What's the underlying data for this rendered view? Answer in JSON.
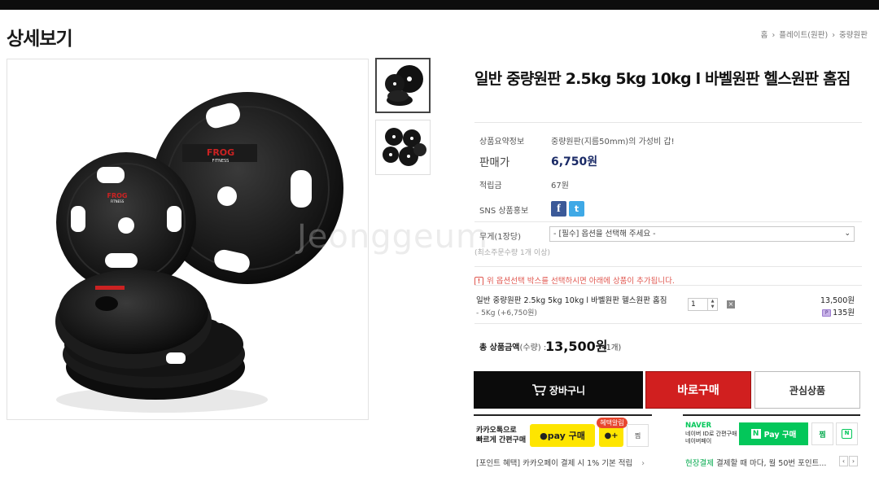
{
  "page": {
    "title": "상세보기",
    "breadcrumb": [
      "홈",
      "플레이트(원판)",
      "중량원판"
    ],
    "watermark": "Jeonggeum"
  },
  "product": {
    "title": "일반 중량원판 2.5kg 5kg 10kg l 바벨원판 헬스원판 홈짐",
    "summary_label": "상품요약정보",
    "summary_value": "중량원판(지름50mm)의 가성비 갑!",
    "price_label": "판매가",
    "price_value": "6,750원",
    "points_label": "적립금",
    "points_value": "67원",
    "sns_label": "SNS 상품홍보",
    "sns": [
      {
        "name": "facebook",
        "glyph": "f",
        "color": "#3b5998"
      },
      {
        "name": "twitter",
        "glyph": "t",
        "color": "#3fa9e6"
      }
    ],
    "brand_print": [
      "FROG",
      "FITNESS"
    ]
  },
  "options": {
    "label": "무게(1장당)",
    "select_value": "- [필수] 옵션을 선택해 주세요 -",
    "min_qty": "(최소주문수량 1개 이상)",
    "notice": "위 옵션선택 박스를 선택하시면 아래에 상품이 추가됩니다."
  },
  "selected": {
    "name": "일반 중량원판 2.5kg 5kg 10kg l 바벨원판 헬스원판 홈짐",
    "option": "- 5Kg (+6,750원)",
    "qty": "1",
    "delete_glyph": "×",
    "price": "13,500원",
    "point": "135원",
    "point_badge": "P"
  },
  "total": {
    "label": "총 상품금액",
    "label_suffix": "(수량) :",
    "value": "13,500원",
    "count": "(1개)"
  },
  "buttons": {
    "cart": "장바구니",
    "buy": "바로구매",
    "wish": "관심상품"
  },
  "kakao": {
    "text_line1": "카카오톡으로",
    "text_line2": "빠르게 간편구매",
    "pay_label": "●pay 구매",
    "plus_label": "●+",
    "badge": "혜택알림",
    "zzim": "찜",
    "point_benefit_label": "[포인트 혜택]",
    "point_benefit_text": "카카오페이 결제 시 1% 기본 적립",
    "chevron": "›"
  },
  "naver": {
    "logo": "NAVER",
    "sub_line1": "네이버 ID로 간편구매",
    "sub_line2": "네이버페이",
    "pay_label": "Pay 구매",
    "pay_badge": "N",
    "zzim": "찜",
    "talk": "N",
    "event_green": "현장결제",
    "event_text": "결제할 때 마다, 월 50번 포인트...",
    "prev": "‹",
    "next": "›"
  }
}
